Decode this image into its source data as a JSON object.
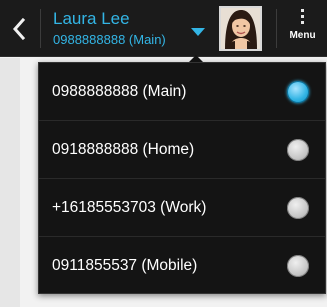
{
  "action_bar": {
    "contact_name": "Laura Lee",
    "contact_number": "0988888888 (Main)",
    "menu_label": "Menu"
  },
  "numbers": [
    {
      "label": "0988888888 (Main)",
      "selected": true
    },
    {
      "label": "0918888888 (Home)",
      "selected": false
    },
    {
      "label": "+16185553703 (Work)",
      "selected": false
    },
    {
      "label": "0911855537 (Mobile)",
      "selected": false
    }
  ],
  "colors": {
    "accent": "#33b5e5",
    "action_bar_bg": "#1b1b1b",
    "popup_bg": "#141414"
  },
  "icons": {
    "back": "chevron-left-icon",
    "dropdown": "dropdown-triangle-icon",
    "menu": "overflow-menu-icon"
  }
}
